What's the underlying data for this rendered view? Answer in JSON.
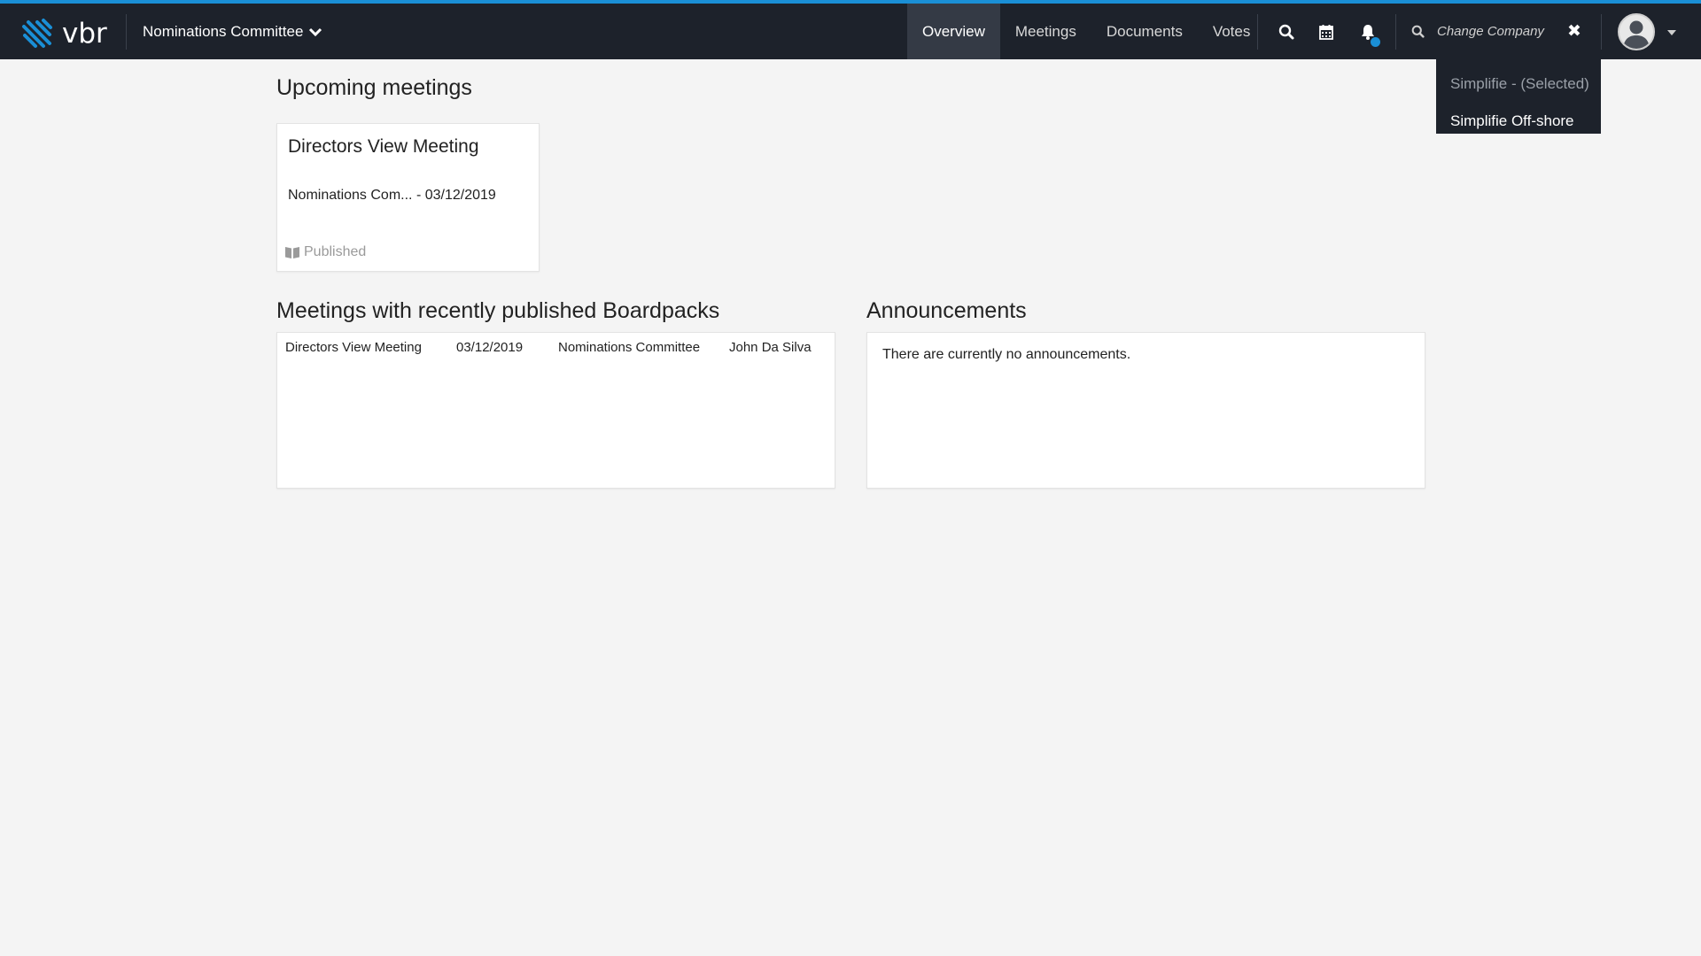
{
  "header": {
    "logo_text": "vbr",
    "committee_selector": "Nominations Committee",
    "tabs": [
      {
        "label": "Overview",
        "active": true
      },
      {
        "label": "Meetings",
        "active": false
      },
      {
        "label": "Documents",
        "active": false
      },
      {
        "label": "Votes",
        "active": false
      }
    ],
    "change_company_label": "Change Company",
    "icons": [
      "search-icon",
      "calendar-icon",
      "bell-icon",
      "search-icon",
      "close-icon",
      "avatar",
      "caret-down-icon"
    ],
    "notification_dot_color": "#1a8fd6"
  },
  "company_dropdown": {
    "items": [
      {
        "label": "Simplifie - (Selected)",
        "selected": true
      },
      {
        "label": "Simplifie Off-shore",
        "selected": false
      }
    ]
  },
  "upcoming": {
    "title": "Upcoming meetings",
    "card": {
      "title": "Directors View Meeting",
      "subtitle": "Nominations Com... - 03/12/2019",
      "status": "Published"
    }
  },
  "boardpacks": {
    "title": "Meetings with recently published Boardpacks",
    "rows": [
      {
        "meeting": "Directors View Meeting",
        "date": "03/12/2019",
        "committee": "Nominations Committee",
        "person": "John Da Silva"
      }
    ]
  },
  "announcements": {
    "title": "Announcements",
    "empty_text": "There are currently no announcements."
  },
  "colors": {
    "navbar": "#1d222b",
    "accent": "#1a8fd6",
    "background": "#f4f4f4"
  }
}
